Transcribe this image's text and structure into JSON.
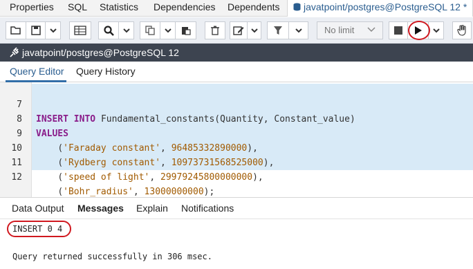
{
  "top_tabs": {
    "properties": "Properties",
    "sql": "SQL",
    "statistics": "Statistics",
    "dependencies": "Dependencies",
    "dependents": "Dependents",
    "query_tool": "javatpoint/postgres@PostgreSQL 12 *"
  },
  "toolbar": {
    "limit_select": "No limit",
    "icons": [
      "open-file-icon",
      "save-icon",
      "chevron-down-icon",
      "grid-icon",
      "search-icon",
      "chevron-down-icon",
      "copy-icon",
      "paste-icon",
      "delete-icon",
      "edit-icon",
      "chevron-down-icon",
      "filter-icon",
      "chevron-down-icon",
      "stop-icon",
      "execute-icon",
      "chevron-down-icon",
      "hand-icon"
    ]
  },
  "connection": {
    "label": "javatpoint/postgres@PostgreSQL 12"
  },
  "query_tabs": {
    "editor": "Query Editor",
    "history": "Query History"
  },
  "editor": {
    "lines": [
      {
        "num": "7",
        "kw1": "INSERT",
        "kw2": "INTO",
        "text": "Fundamental_constants(Quantity, Constant_value)"
      },
      {
        "num": "8",
        "kw1": "VALUES"
      },
      {
        "num": "9",
        "str": "'Faraday constant'",
        "val": "96485332890000",
        "tail": "),"
      },
      {
        "num": "10",
        "str": "'Rydberg constant'",
        "val": "10973731568525000",
        "tail": "),"
      },
      {
        "num": "11",
        "str": "'speed of light'",
        "val": "29979245800000000",
        "tail": "),"
      },
      {
        "num": "12",
        "str": "'Bohr_radius'",
        "val": "13000000000",
        "tail": ");"
      }
    ]
  },
  "output": {
    "tabs": {
      "data_output": "Data Output",
      "messages": "Messages",
      "explain": "Explain",
      "notifications": "Notifications"
    },
    "result": "INSERT 0 4",
    "status": "Query returned successfully in 306 msec."
  },
  "colors": {
    "highlight": "#d0181f",
    "selection": "#d8eaf7",
    "conn_bar": "#3d4450"
  }
}
